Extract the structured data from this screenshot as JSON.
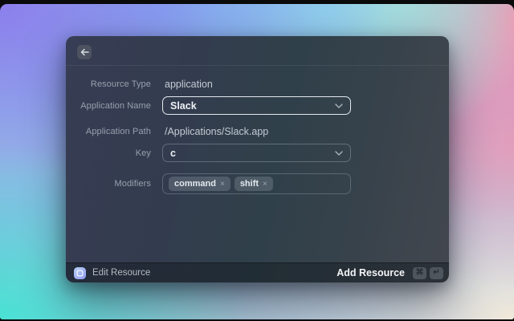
{
  "icons": {
    "back": "left-arrow",
    "chevron": "chevron-down",
    "remove": "×",
    "command_key": "⌘",
    "return_key": "↵"
  },
  "window": {
    "form": {
      "fields": [
        {
          "label": "Resource Type",
          "type": "static",
          "value": "application"
        },
        {
          "label": "Application Name",
          "type": "select",
          "value": "Slack",
          "state": "focused"
        },
        {
          "label": "Application Path",
          "type": "static",
          "value": "/Applications/Slack.app"
        },
        {
          "label": "Key",
          "type": "select",
          "value": "c"
        },
        {
          "label": "Modifiers",
          "type": "tags",
          "tags": [
            "command",
            "shift"
          ]
        }
      ]
    },
    "footer": {
      "mode_label": "Edit Resource",
      "submit_label": "Add Resource",
      "shortcuts": [
        "⌘",
        "↵"
      ]
    }
  },
  "colors": {
    "focused_field_border": "#e3e8ee",
    "window_gradient": [
      "#373d54",
      "#30404a",
      "#43474f"
    ],
    "footer_bg": "#272d33",
    "wallpaper": [
      "#8c7fec",
      "#82a0f0",
      "#91dcec",
      "#ef92b3",
      "#49e2d3",
      "#f1e9da"
    ]
  }
}
